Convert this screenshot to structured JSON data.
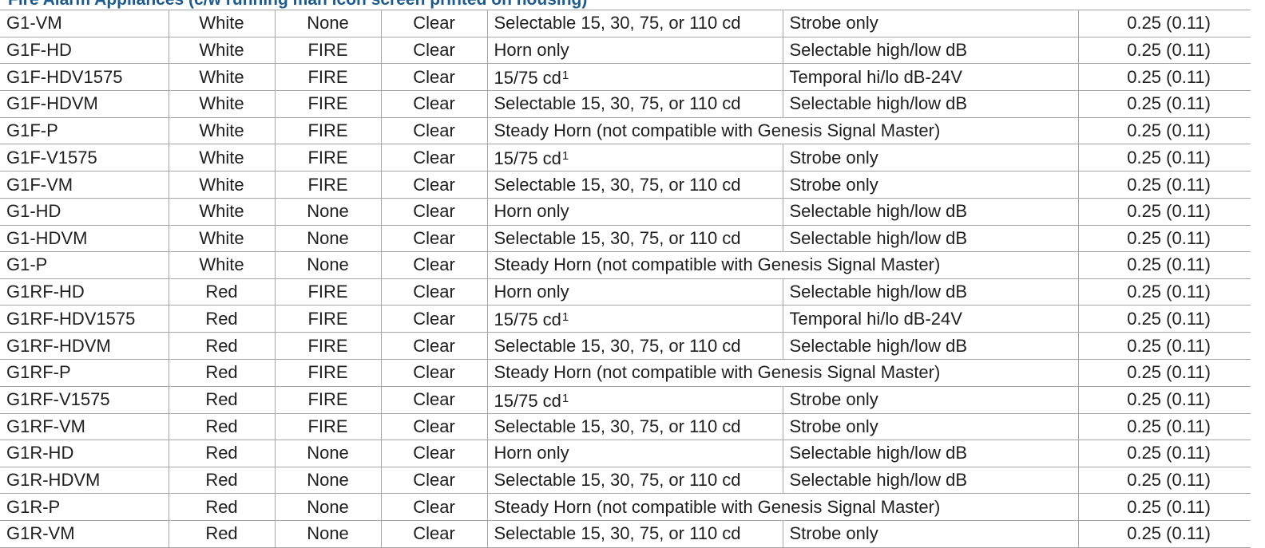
{
  "section_title": "Fire Alarm Appliances (c/w running man icon screen printed on housing)",
  "rows": [
    {
      "model": "G1-VM",
      "color": "White",
      "marking": "None",
      "lens": "Clear",
      "strobe": "Selectable 15, 30, 75, or 110 cd",
      "sup": "",
      "audible": "Strobe only",
      "merged": "",
      "weight": "0.25  (0.11)"
    },
    {
      "model": "G1F-HD",
      "color": "White",
      "marking": "FIRE",
      "lens": "Clear",
      "strobe": "Horn only",
      "sup": "",
      "audible": "Selectable high/low dB",
      "merged": "",
      "weight": "0.25  (0.11)"
    },
    {
      "model": "G1F-HDV1575",
      "color": "White",
      "marking": "FIRE",
      "lens": "Clear",
      "strobe": "15/75 cd",
      "sup": "1",
      "audible": "Temporal hi/lo dB-24V",
      "merged": "",
      "weight": "0.25  (0.11)"
    },
    {
      "model": "G1F-HDVM",
      "color": "White",
      "marking": "FIRE",
      "lens": "Clear",
      "strobe": "Selectable 15, 30, 75, or 110 cd",
      "sup": "",
      "audible": "Selectable high/low dB",
      "merged": "",
      "weight": "0.25  (0.11)"
    },
    {
      "model": "G1F-P",
      "color": "White",
      "marking": "FIRE",
      "lens": "Clear",
      "strobe": "",
      "sup": "",
      "audible": "",
      "merged": "Steady Horn (not compatible with Genesis Signal Master)",
      "weight": "0.25  (0.11)"
    },
    {
      "model": "G1F-V1575",
      "color": "White",
      "marking": "FIRE",
      "lens": "Clear",
      "strobe": "15/75 cd",
      "sup": "1",
      "audible": "Strobe only",
      "merged": "",
      "weight": "0.25  (0.11)"
    },
    {
      "model": "G1F-VM",
      "color": "White",
      "marking": "FIRE",
      "lens": "Clear",
      "strobe": "Selectable 15, 30, 75, or 110 cd",
      "sup": "",
      "audible": "Strobe only",
      "merged": "",
      "weight": "0.25  (0.11)"
    },
    {
      "model": "G1-HD",
      "color": "White",
      "marking": "None",
      "lens": "Clear",
      "strobe": "Horn only",
      "sup": "",
      "audible": "Selectable high/low dB",
      "merged": "",
      "weight": "0.25  (0.11)"
    },
    {
      "model": "G1-HDVM",
      "color": "White",
      "marking": "None",
      "lens": "Clear",
      "strobe": "Selectable 15, 30, 75, or 110 cd",
      "sup": "",
      "audible": "Selectable high/low dB",
      "merged": "",
      "weight": "0.25  (0.11)"
    },
    {
      "model": "G1-P",
      "color": "White",
      "marking": "None",
      "lens": "Clear",
      "strobe": "",
      "sup": "",
      "audible": "",
      "merged": "Steady Horn (not compatible with Genesis Signal Master)",
      "weight": "0.25  (0.11)"
    },
    {
      "model": "G1RF-HD",
      "color": "Red",
      "marking": "FIRE",
      "lens": "Clear",
      "strobe": "Horn only",
      "sup": "",
      "audible": "Selectable high/low dB",
      "merged": "",
      "weight": "0.25  (0.11)"
    },
    {
      "model": "G1RF-HDV1575",
      "color": "Red",
      "marking": "FIRE",
      "lens": "Clear",
      "strobe": "15/75 cd",
      "sup": "1",
      "audible": "Temporal hi/lo dB-24V",
      "merged": "",
      "weight": "0.25  (0.11)"
    },
    {
      "model": "G1RF-HDVM",
      "color": "Red",
      "marking": "FIRE",
      "lens": "Clear",
      "strobe": "Selectable 15, 30, 75, or 110 cd",
      "sup": "",
      "audible": "Selectable high/low dB",
      "merged": "",
      "weight": "0.25  (0.11)"
    },
    {
      "model": "G1RF-P",
      "color": "Red",
      "marking": "FIRE",
      "lens": "Clear",
      "strobe": "",
      "sup": "",
      "audible": "",
      "merged": "Steady Horn (not compatible with Genesis Signal Master)",
      "weight": "0.25  (0.11)"
    },
    {
      "model": "G1RF-V1575",
      "color": "Red",
      "marking": "FIRE",
      "lens": "Clear",
      "strobe": "15/75 cd",
      "sup": "1",
      "audible": "Strobe only",
      "merged": "",
      "weight": "0.25  (0.11)"
    },
    {
      "model": "G1RF-VM",
      "color": "Red",
      "marking": "FIRE",
      "lens": "Clear",
      "strobe": "Selectable 15, 30, 75, or 110 cd",
      "sup": "",
      "audible": "Strobe only",
      "merged": "",
      "weight": "0.25  (0.11)"
    },
    {
      "model": "G1R-HD",
      "color": "Red",
      "marking": "None",
      "lens": "Clear",
      "strobe": "Horn only",
      "sup": "",
      "audible": "Selectable high/low dB",
      "merged": "",
      "weight": "0.25  (0.11)"
    },
    {
      "model": "G1R-HDVM",
      "color": "Red",
      "marking": "None",
      "lens": "Clear",
      "strobe": "Selectable 15, 30, 75, or 110 cd",
      "sup": "",
      "audible": "Selectable high/low dB",
      "merged": "",
      "weight": "0.25  (0.11)"
    },
    {
      "model": "G1R-P",
      "color": "Red",
      "marking": "None",
      "lens": "Clear",
      "strobe": "",
      "sup": "",
      "audible": "",
      "merged": "Steady Horn (not compatible with Genesis Signal Master)",
      "weight": "0.25  (0.11)"
    },
    {
      "model": "G1R-VM",
      "color": "Red",
      "marking": "None",
      "lens": "Clear",
      "strobe": "Selectable 15, 30, 75, or 110 cd",
      "sup": "",
      "audible": "Strobe only",
      "merged": "",
      "weight": "0.25  (0.11)"
    }
  ]
}
